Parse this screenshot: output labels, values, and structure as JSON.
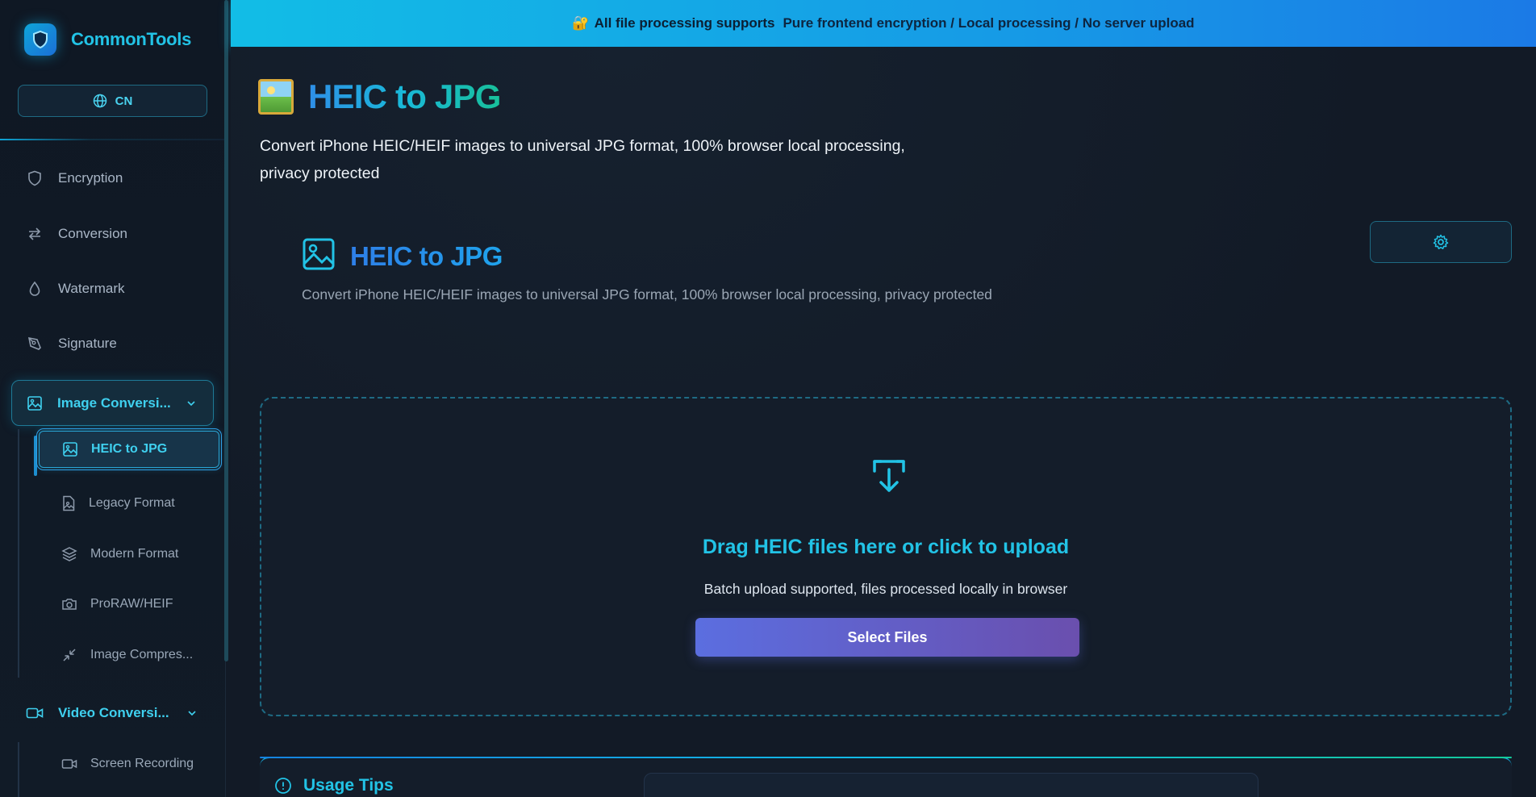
{
  "brand": {
    "name": "CommonTools"
  },
  "language": {
    "label": "CN"
  },
  "sidebar": {
    "items": [
      {
        "label": "Encryption",
        "icon": "shield-icon"
      },
      {
        "label": "Conversion",
        "icon": "arrows-swap-icon"
      },
      {
        "label": "Watermark",
        "icon": "droplet-icon"
      },
      {
        "label": "Signature",
        "icon": "pen-tool-icon"
      }
    ],
    "image_group": {
      "label": "Image Conversi...",
      "icon": "image-icon",
      "children": [
        {
          "label": "HEIC to JPG",
          "icon": "image-icon",
          "active": true
        },
        {
          "label": "Legacy Format",
          "icon": "file-image-icon"
        },
        {
          "label": "Modern Format",
          "icon": "layers-icon"
        },
        {
          "label": "ProRAW/HEIF",
          "icon": "camera-icon"
        },
        {
          "label": "Image Compres...",
          "icon": "minimize-icon"
        }
      ]
    },
    "video_group": {
      "label": "Video Conversi...",
      "icon": "video-icon",
      "children": [
        {
          "label": "Screen Recording",
          "icon": "video-icon"
        }
      ]
    }
  },
  "banner": {
    "emoji": "🔐",
    "bold": "All file processing supports",
    "text": "Pure frontend encryption / Local processing / No server upload"
  },
  "page": {
    "title": "HEIC to JPG",
    "description": "Convert iPhone HEIC/HEIF images to universal JPG format, 100% browser local processing, privacy protected"
  },
  "card": {
    "title": "HEIC to JPG",
    "description": "Convert iPhone HEIC/HEIF images to universal JPG format, 100% browser local processing, privacy protected"
  },
  "dropzone": {
    "title": "Drag HEIC files here or click to upload",
    "subtitle": "Batch upload supported, files processed locally in browser",
    "button": "Select Files"
  },
  "tips": {
    "title": "Usage Tips"
  },
  "colors": {
    "accent": "#22c3e6",
    "background": "#121a26",
    "button_gradient_start": "#5b6ee0",
    "button_gradient_end": "#6a4fae"
  }
}
